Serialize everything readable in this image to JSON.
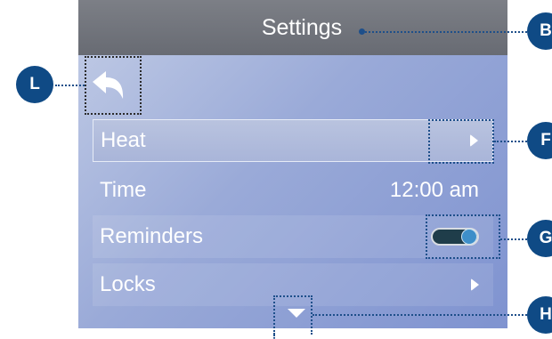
{
  "header": {
    "title": "Settings"
  },
  "back": {
    "icon": "back-arrow-icon"
  },
  "rows": [
    {
      "label": "Heat",
      "control": "chevron-right-icon",
      "selected": true
    },
    {
      "label": "Time",
      "value": "12:00 am"
    },
    {
      "label": "Reminders",
      "control": "toggle-switch",
      "state": "on"
    },
    {
      "label": "Locks",
      "control": "chevron-right-icon"
    }
  ],
  "scroll": {
    "icon": "scroll-down-icon"
  },
  "callouts": {
    "b": "B",
    "f": "F",
    "g": "G",
    "h": "H",
    "l": "L"
  },
  "colors": {
    "header": "#6f727a",
    "badge": "#0f4a85",
    "toggle_knob": "#3e8fc9"
  }
}
